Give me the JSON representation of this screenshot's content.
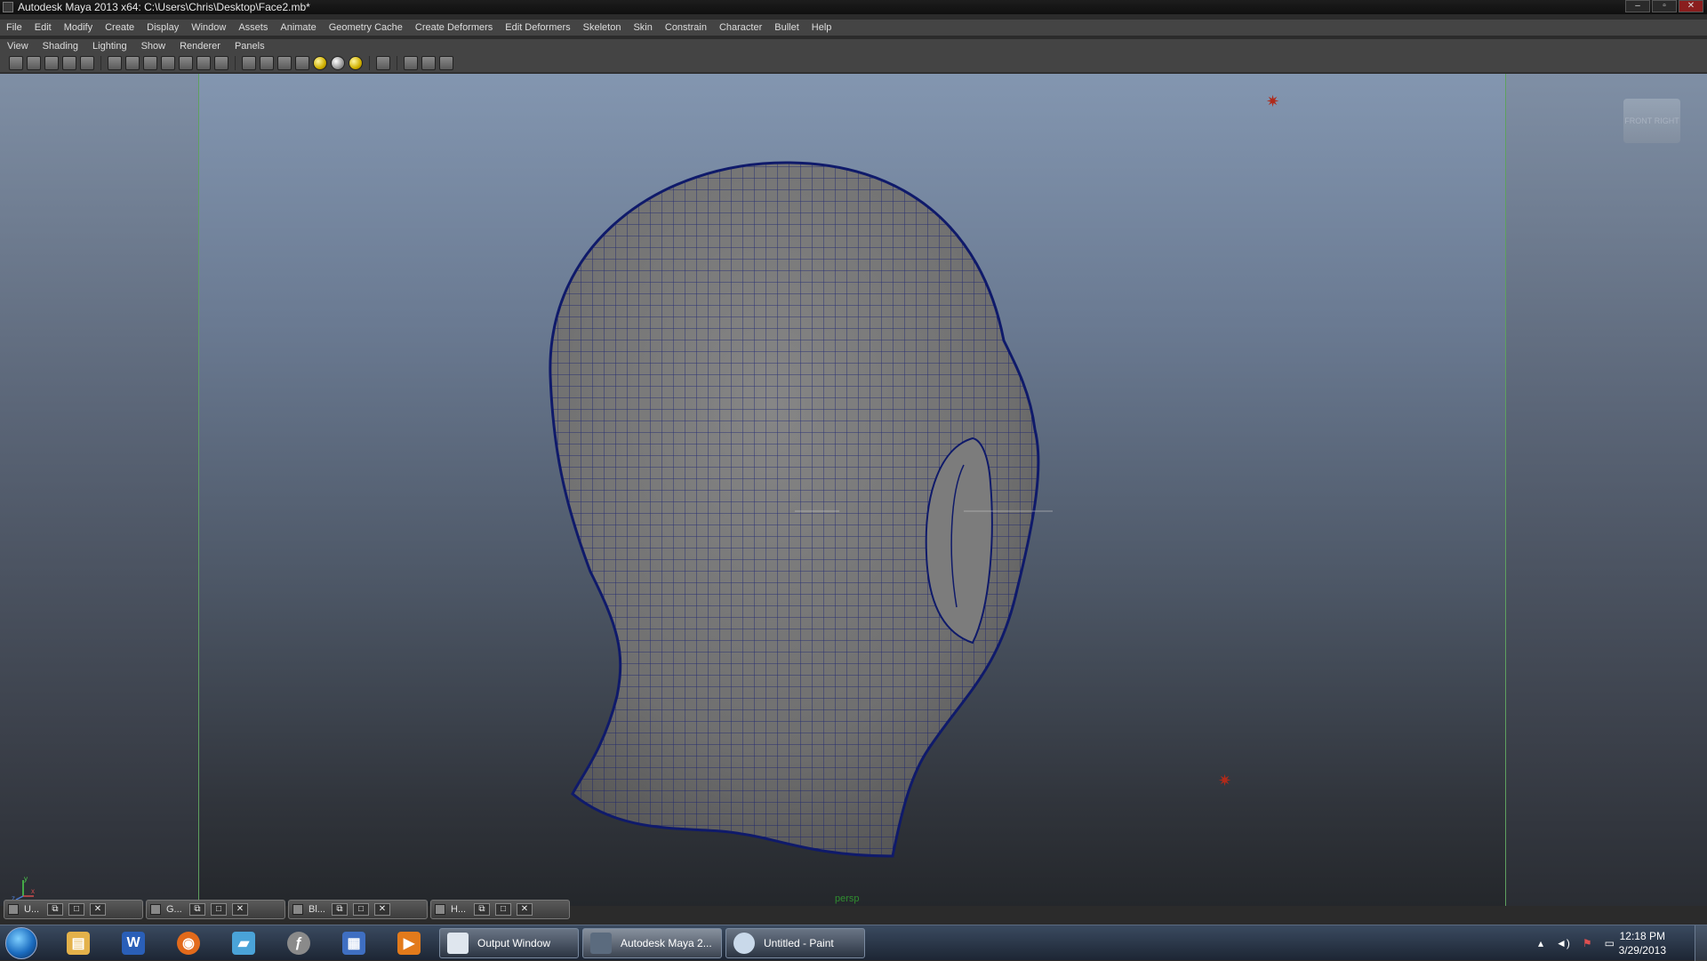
{
  "window": {
    "title": "Autodesk Maya 2013 x64: C:\\Users\\Chris\\Desktop\\Face2.mb*",
    "controls": [
      "–",
      "▫",
      "✕"
    ]
  },
  "main_menu": [
    "File",
    "Edit",
    "Modify",
    "Create",
    "Display",
    "Window",
    "Assets",
    "Animate",
    "Geometry Cache",
    "Create Deformers",
    "Edit Deformers",
    "Skeleton",
    "Skin",
    "Constrain",
    "Character",
    "Bullet",
    "Help"
  ],
  "panel_menu": [
    "View",
    "Shading",
    "Lighting",
    "Show",
    "Renderer",
    "Panels"
  ],
  "viewport": {
    "camera_label": "persp",
    "viewcube_faces": [
      "FRONT",
      "RIGHT"
    ],
    "axis": {
      "x": "x",
      "y": "y",
      "z": "z"
    }
  },
  "minimized_panels": [
    {
      "label": "U...",
      "buttons": [
        "⧉",
        "□",
        "✕"
      ]
    },
    {
      "label": "G...",
      "buttons": [
        "⧉",
        "□",
        "✕"
      ]
    },
    {
      "label": "Bl...",
      "buttons": [
        "⧉",
        "□",
        "✕"
      ]
    },
    {
      "label": "H...",
      "buttons": [
        "⧉",
        "□",
        "✕"
      ]
    }
  ],
  "taskbar": {
    "pinned": [
      {
        "icon": "folder-icon",
        "glyph": "▤",
        "color": "#e3b14a"
      },
      {
        "icon": "word-icon",
        "glyph": "W",
        "color": "#2a5fb8"
      },
      {
        "icon": "firefox-icon",
        "glyph": "◉",
        "color": "#e26a1b"
      },
      {
        "icon": "notes-icon",
        "glyph": "▰",
        "color": "#4aa3d8"
      },
      {
        "icon": "flash-icon",
        "glyph": "ƒ",
        "color": "#8a8a8a"
      },
      {
        "icon": "network-icon",
        "glyph": "▦",
        "color": "#3f6fc2"
      },
      {
        "icon": "media-player-icon",
        "glyph": "▶",
        "color": "#e27a1b"
      }
    ],
    "tasks": [
      {
        "label": "Output Window",
        "active": false
      },
      {
        "label": "Autodesk Maya 2...",
        "active": true
      },
      {
        "label": "Untitled - Paint",
        "active": false
      }
    ],
    "clock_time": "12:18 PM",
    "clock_date": "3/29/2013"
  },
  "colors": {
    "wireframe": "#101a70",
    "selection_border": "#5fa05f",
    "light_marker": "#b02a1a"
  }
}
